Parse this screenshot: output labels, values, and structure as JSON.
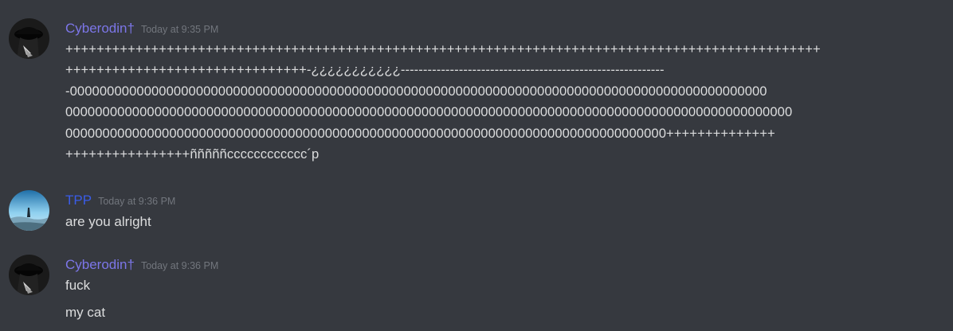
{
  "colors": {
    "background": "#36393f",
    "cyberodin_name": "#7c76e8",
    "tpp_name": "#3a5ce8",
    "timestamp": "#72767d",
    "message_text": "#dcddde"
  },
  "messages": [
    {
      "username": "Cyberodin†",
      "timestamp": "Today at 9:35 PM",
      "avatar": "dark-hooded-figure-avatar",
      "lines": [
        "+++++++++++++++++++++++++++++++++++++++++++++++++++++++++++++++++++++++++++++++++++++++++++++++++",
        "+++++++++++++++++++++++++++++++-¿¿¿¿¿¿¿¿¿¿¿-----------------------------------------------------------",
        "-0000000000000000000000000000000000000000000000000000000000000000000000000000000000000000000000",
        "00000000000000000000000000000000000000000000000000000000000000000000000000000000000000000000000000",
        "000000000000000000000000000000000000000000000000000000000000000000000000000000000++++++++++++++",
        "++++++++++++++++ñññññcccccccccccc´p"
      ]
    },
    {
      "username": "TPP",
      "timestamp": "Today at 9:36 PM",
      "avatar": "landscape-sky-avatar",
      "lines": [
        "are you alright"
      ]
    },
    {
      "username": "Cyberodin†",
      "timestamp": "Today at 9:36 PM",
      "avatar": "dark-hooded-figure-avatar",
      "lines": [
        "fuck",
        "my cat"
      ]
    }
  ]
}
